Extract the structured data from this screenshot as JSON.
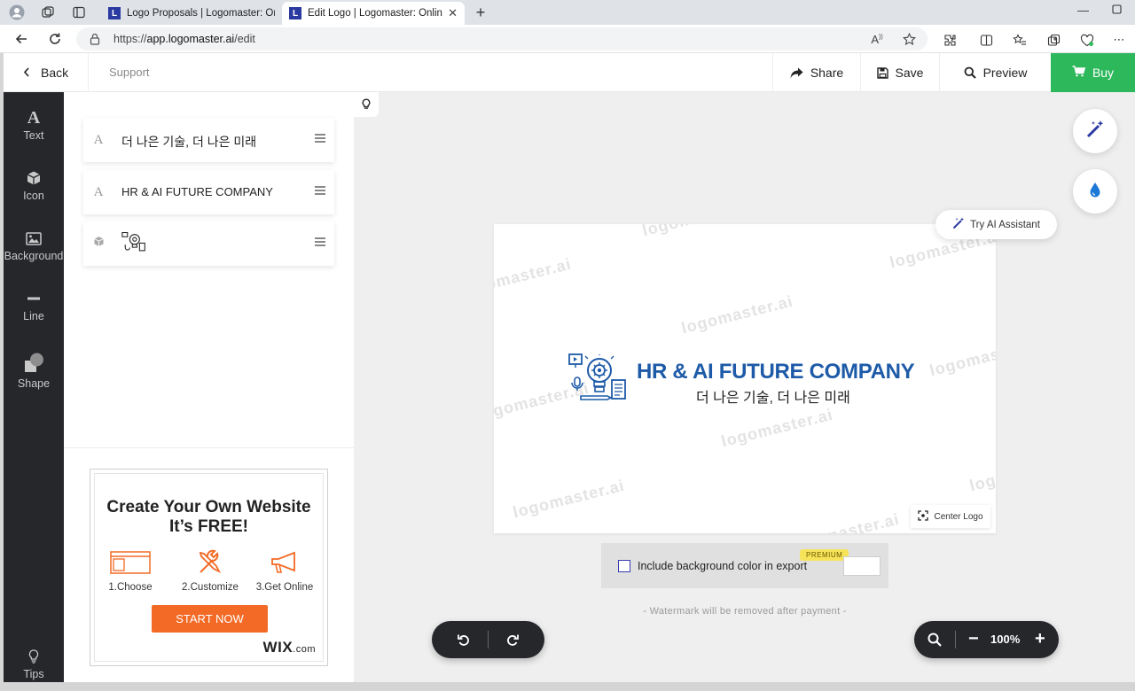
{
  "browser": {
    "tabs": [
      {
        "title": "Logo Proposals | Logomaster: Online",
        "favicon": "L"
      },
      {
        "title": "Edit Logo | Logomaster: Online L",
        "favicon": "L"
      }
    ],
    "url_prefix": "https://",
    "url_host": "app.logomaster.ai",
    "url_path": "/edit"
  },
  "header": {
    "back_label": "Back",
    "support_label": "Support",
    "share_label": "Share",
    "save_label": "Save",
    "preview_label": "Preview",
    "buy_label": "Buy",
    "buy_color": "#2eb85c"
  },
  "tools": [
    {
      "label": "Text",
      "icon": "text-icon"
    },
    {
      "label": "Icon",
      "icon": "cube-icon"
    },
    {
      "label": "Background",
      "icon": "image-icon"
    },
    {
      "label": "Line",
      "icon": "line-icon"
    },
    {
      "label": "Shape",
      "icon": "shape-icon"
    },
    {
      "label": "Tips",
      "icon": "lightbulb-icon"
    }
  ],
  "layers": [
    {
      "type": "text",
      "type_glyph": "A",
      "label": "더 나은 기술, 더 나은 미래"
    },
    {
      "type": "text",
      "type_glyph": "A",
      "label": "HR & AI FUTURE COMPANY"
    },
    {
      "type": "icon",
      "type_glyph": "",
      "label": ""
    }
  ],
  "ad": {
    "title_line1": "Create Your Own Website",
    "title_line2": "It’s FREE!",
    "steps": [
      "1.Choose",
      "2.Customize",
      "3.Get Online"
    ],
    "cta": "START NOW",
    "brand": "WIX",
    "brand_suffix": ".com",
    "accent_color": "#f26a25"
  },
  "canvas": {
    "logo_title": "HR & AI FUTURE COMPANY",
    "logo_subtitle": "더 나은 기술, 더 나은 미래",
    "logo_color": "#1d5aa8",
    "watermark": "logomaster.ai",
    "center_logo_label": "Center Logo",
    "ai_assistant_label": "Try AI Assistant"
  },
  "export": {
    "checkbox_label": "Include background color in export",
    "premium_badge": "PREMIUM",
    "checked": false
  },
  "watermark_note": "- Watermark will be removed after payment -",
  "zoom": {
    "value": "100%"
  }
}
